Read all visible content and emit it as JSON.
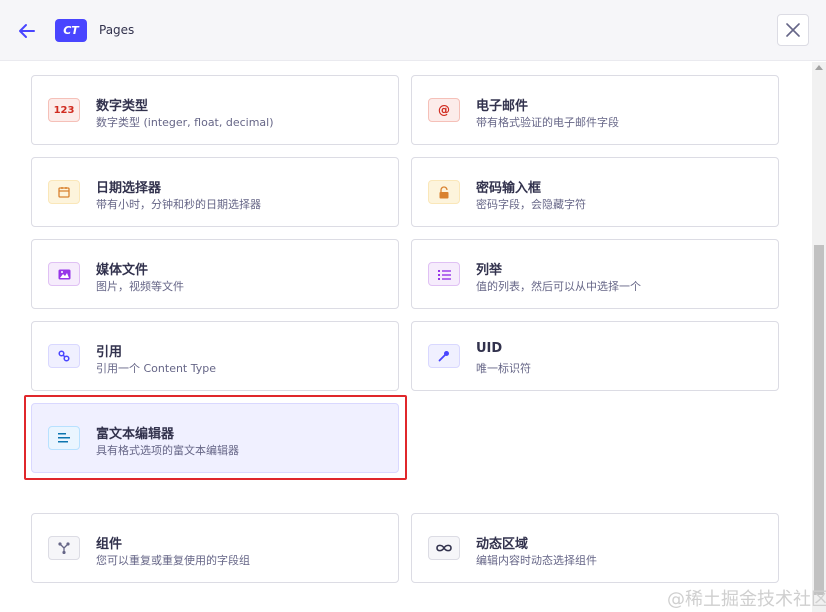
{
  "header": {
    "badge": "CT",
    "title": "Pages"
  },
  "fields": [
    {
      "title": "数字类型",
      "desc": "数字类型 (integer, float, decimal)",
      "icon": "number-icon",
      "icon_text": "123",
      "color": "#d02b20",
      "bg": "#fcecea",
      "border": "#f5c0b8"
    },
    {
      "title": "电子邮件",
      "desc": "带有格式验证的电子邮件字段",
      "icon": "email-icon",
      "icon_text": "@",
      "color": "#d02b20",
      "bg": "#fcecea",
      "border": "#f5c0b8"
    },
    {
      "title": "日期选择器",
      "desc": "带有小时，分钟和秒的日期选择器",
      "icon": "calendar-icon",
      "color": "#d9822f",
      "bg": "#fdf4dc",
      "border": "#fae7b9"
    },
    {
      "title": "密码输入框",
      "desc": "密码字段，会隐藏字符",
      "icon": "lock-icon",
      "color": "#d9822f",
      "bg": "#fdf4dc",
      "border": "#fae7b9"
    },
    {
      "title": "媒体文件",
      "desc": "图片，视频等文件",
      "icon": "image-icon",
      "color": "#9736e8",
      "bg": "#f6ecfc",
      "border": "#e0c1f4"
    },
    {
      "title": "列举",
      "desc": "值的列表，然后可以从中选择一个",
      "icon": "list-icon",
      "color": "#9736e8",
      "bg": "#f6ecfc",
      "border": "#e0c1f4"
    },
    {
      "title": "引用",
      "desc": "引用一个 Content Type",
      "icon": "link-icon",
      "color": "#4945ff",
      "bg": "#f0f0ff",
      "border": "#d9d8ff"
    },
    {
      "title": "UID",
      "desc": "唯一标识符",
      "icon": "key-icon",
      "color": "#4945ff",
      "bg": "#f0f0ff",
      "border": "#d9d8ff"
    },
    {
      "title": "富文本编辑器",
      "desc": "具有格式选项的富文本编辑器",
      "icon": "rich-text-icon",
      "color": "#0c75af",
      "bg": "#eaf5ff",
      "border": "#b8e1ff"
    }
  ],
  "structures": [
    {
      "title": "组件",
      "desc": "您可以重复或重复使用的字段组",
      "icon": "component-icon",
      "color": "#666687",
      "bg": "#f6f6f9",
      "border": "#dcdce4"
    },
    {
      "title": "动态区域",
      "desc": "编辑内容时动态选择组件",
      "icon": "infinity-icon",
      "color": "#666687",
      "bg": "#f6f6f9",
      "border": "#dcdce4"
    }
  ],
  "watermark": "@稀土掘金技术社区"
}
